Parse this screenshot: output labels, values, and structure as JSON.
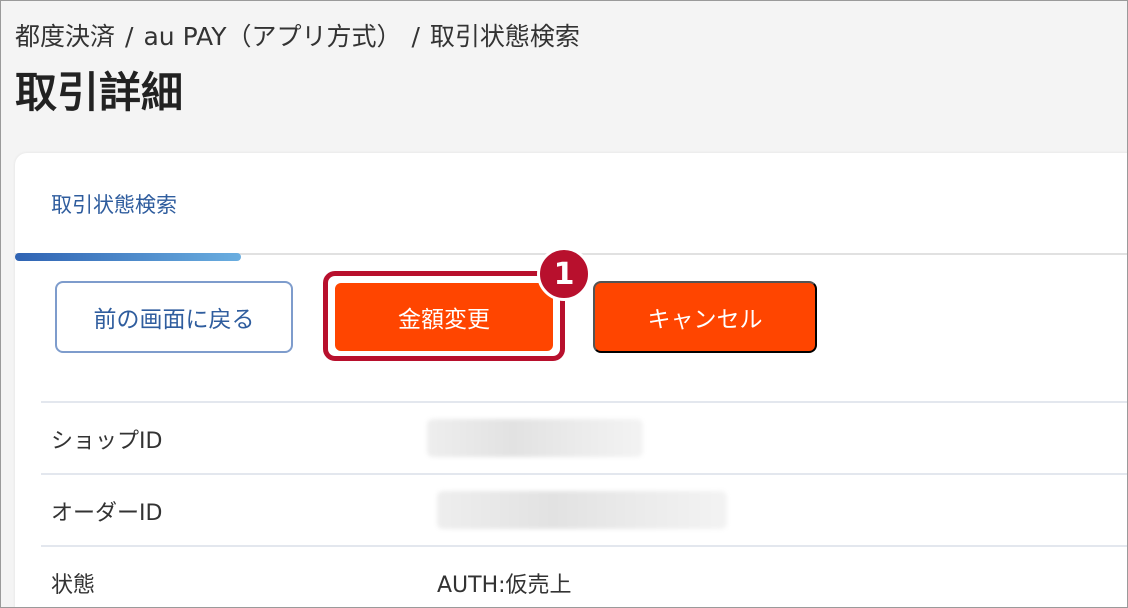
{
  "breadcrumb": {
    "items": [
      "都度決済",
      "au PAY（アプリ方式）",
      "取引状態検索"
    ],
    "separator": "/"
  },
  "page": {
    "title": "取引詳細"
  },
  "tabs": [
    {
      "label": "取引状態検索",
      "active": true
    }
  ],
  "actions": {
    "back_label": "前の画面に戻る",
    "change_amount_label": "金額変更",
    "cancel_label": "キャンセル"
  },
  "annotation": {
    "step_number": "1"
  },
  "details": {
    "rows": [
      {
        "label": "ショップID",
        "value": ""
      },
      {
        "label": "オーダーID",
        "value": ""
      },
      {
        "label": "状態",
        "value": "AUTH:仮売上"
      }
    ]
  },
  "colors": {
    "primary_button": "#ff4500",
    "link_blue": "#2f5d9e",
    "highlight_red": "#b8102d"
  }
}
